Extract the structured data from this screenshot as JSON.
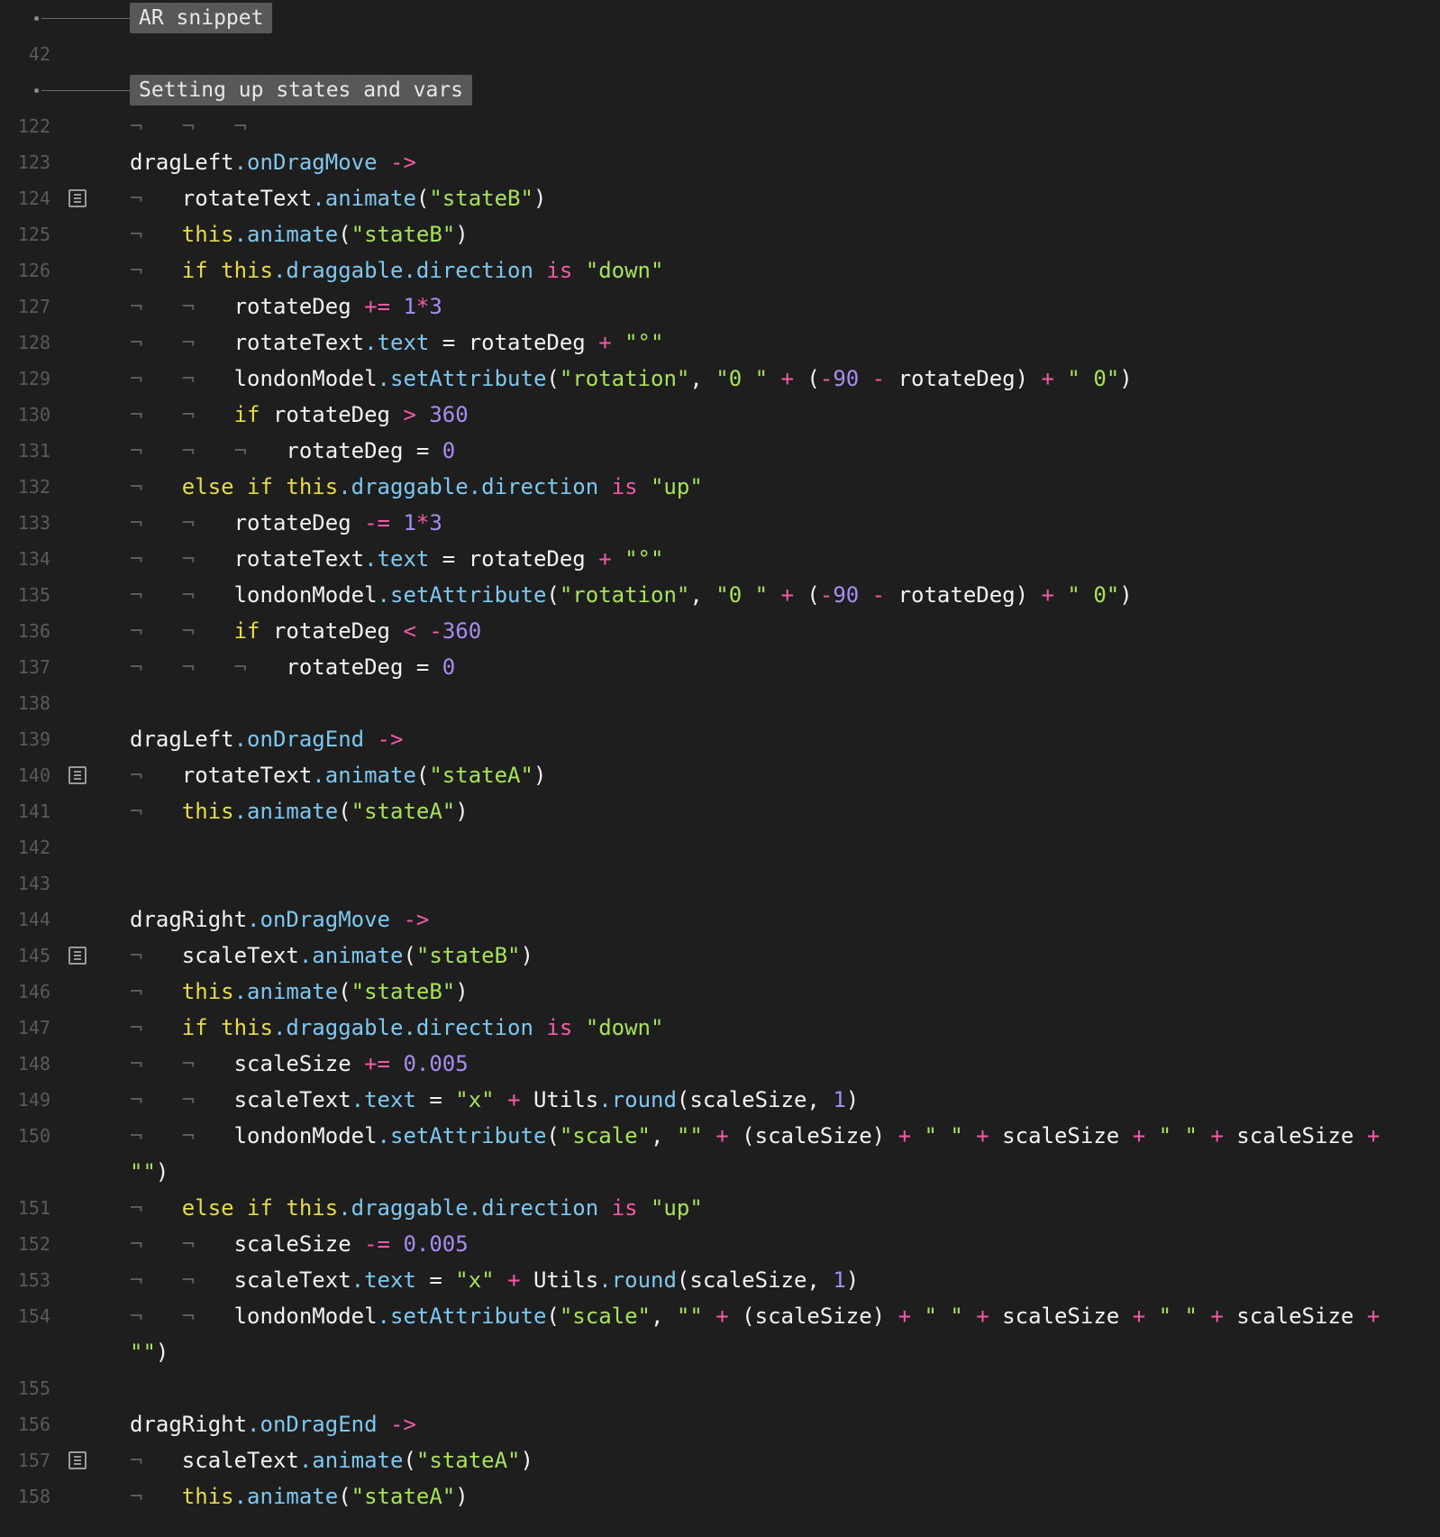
{
  "sections": [
    {
      "label": "AR snippet"
    },
    {
      "label": "Setting up states and vars"
    }
  ],
  "line_numbers": [
    "42",
    "122",
    "123",
    "124",
    "125",
    "126",
    "127",
    "128",
    "129",
    "130",
    "131",
    "132",
    "133",
    "134",
    "135",
    "136",
    "137",
    "138",
    "139",
    "140",
    "141",
    "142",
    "143",
    "144",
    "145",
    "146",
    "147",
    "148",
    "149",
    "150",
    "151",
    "152",
    "153",
    "154",
    "155",
    "156",
    "157",
    "158"
  ],
  "lines": [
    {
      "n": "122",
      "tabs": "¬   ¬   ¬",
      "fold": false,
      "tokens": []
    },
    {
      "n": "123",
      "tabs": "",
      "fold": false,
      "tokens": [
        [
          "v",
          "dragLeft"
        ],
        [
          "m",
          ".onDragMove"
        ],
        [
          "p",
          " "
        ],
        [
          "o",
          "->"
        ]
      ]
    },
    {
      "n": "124",
      "tabs": "¬   ",
      "fold": true,
      "tokens": [
        [
          "v",
          "rotateText"
        ],
        [
          "m",
          ".animate"
        ],
        [
          "p",
          "("
        ],
        [
          "s",
          "\"stateB\""
        ],
        [
          "p",
          ")"
        ]
      ]
    },
    {
      "n": "125",
      "tabs": "¬   ",
      "fold": false,
      "tokens": [
        [
          "k",
          "this"
        ],
        [
          "m",
          ".animate"
        ],
        [
          "p",
          "("
        ],
        [
          "s",
          "\"stateB\""
        ],
        [
          "p",
          ")"
        ]
      ]
    },
    {
      "n": "126",
      "tabs": "¬   ",
      "fold": false,
      "tokens": [
        [
          "k",
          "if this"
        ],
        [
          "m",
          ".draggable.direction"
        ],
        [
          "p",
          " "
        ],
        [
          "o",
          "is"
        ],
        [
          "p",
          " "
        ],
        [
          "s",
          "\"down\""
        ]
      ]
    },
    {
      "n": "127",
      "tabs": "¬   ¬   ",
      "fold": false,
      "tokens": [
        [
          "v",
          "rotateDeg "
        ],
        [
          "o",
          "+="
        ],
        [
          "p",
          " "
        ],
        [
          "n",
          "1"
        ],
        [
          "o",
          "*"
        ],
        [
          "n",
          "3"
        ]
      ]
    },
    {
      "n": "128",
      "tabs": "¬   ¬   ",
      "fold": false,
      "tokens": [
        [
          "v",
          "rotateText"
        ],
        [
          "m",
          ".text"
        ],
        [
          "p",
          " = rotateDeg "
        ],
        [
          "o",
          "+"
        ],
        [
          "p",
          " "
        ],
        [
          "s",
          "\"°\""
        ]
      ]
    },
    {
      "n": "129",
      "tabs": "¬   ¬   ",
      "fold": false,
      "tokens": [
        [
          "v",
          "londonModel"
        ],
        [
          "m",
          ".setAttribute"
        ],
        [
          "p",
          "("
        ],
        [
          "s",
          "\"rotation\""
        ],
        [
          "p",
          ", "
        ],
        [
          "s",
          "\"0 \""
        ],
        [
          "p",
          " "
        ],
        [
          "o",
          "+"
        ],
        [
          "p",
          " ("
        ],
        [
          "o",
          "-"
        ],
        [
          "n",
          "90"
        ],
        [
          "p",
          " "
        ],
        [
          "o",
          "-"
        ],
        [
          "p",
          " rotateDeg) "
        ],
        [
          "o",
          "+"
        ],
        [
          "p",
          " "
        ],
        [
          "s",
          "\" 0\""
        ],
        [
          "p",
          ")"
        ]
      ]
    },
    {
      "n": "130",
      "tabs": "¬   ¬   ",
      "fold": false,
      "tokens": [
        [
          "k",
          "if"
        ],
        [
          "p",
          " rotateDeg "
        ],
        [
          "o",
          ">"
        ],
        [
          "p",
          " "
        ],
        [
          "n",
          "360"
        ]
      ]
    },
    {
      "n": "131",
      "tabs": "¬   ¬   ¬   ",
      "fold": false,
      "tokens": [
        [
          "v",
          "rotateDeg = "
        ],
        [
          "n",
          "0"
        ]
      ]
    },
    {
      "n": "132",
      "tabs": "¬   ",
      "fold": false,
      "tokens": [
        [
          "k",
          "else if this"
        ],
        [
          "m",
          ".draggable.direction"
        ],
        [
          "p",
          " "
        ],
        [
          "o",
          "is"
        ],
        [
          "p",
          " "
        ],
        [
          "s",
          "\"up\""
        ]
      ]
    },
    {
      "n": "133",
      "tabs": "¬   ¬   ",
      "fold": false,
      "tokens": [
        [
          "v",
          "rotateDeg "
        ],
        [
          "o",
          "-="
        ],
        [
          "p",
          " "
        ],
        [
          "n",
          "1"
        ],
        [
          "o",
          "*"
        ],
        [
          "n",
          "3"
        ]
      ]
    },
    {
      "n": "134",
      "tabs": "¬   ¬   ",
      "fold": false,
      "tokens": [
        [
          "v",
          "rotateText"
        ],
        [
          "m",
          ".text"
        ],
        [
          "p",
          " = rotateDeg "
        ],
        [
          "o",
          "+"
        ],
        [
          "p",
          " "
        ],
        [
          "s",
          "\"°\""
        ]
      ]
    },
    {
      "n": "135",
      "tabs": "¬   ¬   ",
      "fold": false,
      "tokens": [
        [
          "v",
          "londonModel"
        ],
        [
          "m",
          ".setAttribute"
        ],
        [
          "p",
          "("
        ],
        [
          "s",
          "\"rotation\""
        ],
        [
          "p",
          ", "
        ],
        [
          "s",
          "\"0 \""
        ],
        [
          "p",
          " "
        ],
        [
          "o",
          "+"
        ],
        [
          "p",
          " ("
        ],
        [
          "o",
          "-"
        ],
        [
          "n",
          "90"
        ],
        [
          "p",
          " "
        ],
        [
          "o",
          "-"
        ],
        [
          "p",
          " rotateDeg) "
        ],
        [
          "o",
          "+"
        ],
        [
          "p",
          " "
        ],
        [
          "s",
          "\" 0\""
        ],
        [
          "p",
          ")"
        ]
      ]
    },
    {
      "n": "136",
      "tabs": "¬   ¬   ",
      "fold": false,
      "tokens": [
        [
          "k",
          "if"
        ],
        [
          "p",
          " rotateDeg "
        ],
        [
          "o",
          "<"
        ],
        [
          "p",
          " "
        ],
        [
          "o",
          "-"
        ],
        [
          "n",
          "360"
        ]
      ]
    },
    {
      "n": "137",
      "tabs": "¬   ¬   ¬   ",
      "fold": false,
      "tokens": [
        [
          "v",
          "rotateDeg = "
        ],
        [
          "n",
          "0"
        ]
      ]
    },
    {
      "n": "138",
      "tabs": "",
      "fold": false,
      "tokens": []
    },
    {
      "n": "139",
      "tabs": "",
      "fold": false,
      "tokens": [
        [
          "v",
          "dragLeft"
        ],
        [
          "m",
          ".onDragEnd"
        ],
        [
          "p",
          " "
        ],
        [
          "o",
          "->"
        ]
      ]
    },
    {
      "n": "140",
      "tabs": "¬   ",
      "fold": true,
      "tokens": [
        [
          "v",
          "rotateText"
        ],
        [
          "m",
          ".animate"
        ],
        [
          "p",
          "("
        ],
        [
          "s",
          "\"stateA\""
        ],
        [
          "p",
          ")"
        ]
      ]
    },
    {
      "n": "141",
      "tabs": "¬   ",
      "fold": false,
      "tokens": [
        [
          "k",
          "this"
        ],
        [
          "m",
          ".animate"
        ],
        [
          "p",
          "("
        ],
        [
          "s",
          "\"stateA\""
        ],
        [
          "p",
          ")"
        ]
      ]
    },
    {
      "n": "142",
      "tabs": "",
      "fold": false,
      "tokens": []
    },
    {
      "n": "143",
      "tabs": "",
      "fold": false,
      "tokens": []
    },
    {
      "n": "144",
      "tabs": "",
      "fold": false,
      "tokens": [
        [
          "v",
          "dragRight"
        ],
        [
          "m",
          ".onDragMove"
        ],
        [
          "p",
          " "
        ],
        [
          "o",
          "->"
        ]
      ]
    },
    {
      "n": "145",
      "tabs": "¬   ",
      "fold": true,
      "tokens": [
        [
          "v",
          "scaleText"
        ],
        [
          "m",
          ".animate"
        ],
        [
          "p",
          "("
        ],
        [
          "s",
          "\"stateB\""
        ],
        [
          "p",
          ")"
        ]
      ]
    },
    {
      "n": "146",
      "tabs": "¬   ",
      "fold": false,
      "tokens": [
        [
          "k",
          "this"
        ],
        [
          "m",
          ".animate"
        ],
        [
          "p",
          "("
        ],
        [
          "s",
          "\"stateB\""
        ],
        [
          "p",
          ")"
        ]
      ]
    },
    {
      "n": "147",
      "tabs": "¬   ",
      "fold": false,
      "tokens": [
        [
          "k",
          "if this"
        ],
        [
          "m",
          ".draggable.direction"
        ],
        [
          "p",
          " "
        ],
        [
          "o",
          "is"
        ],
        [
          "p",
          " "
        ],
        [
          "s",
          "\"down\""
        ]
      ]
    },
    {
      "n": "148",
      "tabs": "¬   ¬   ",
      "fold": false,
      "tokens": [
        [
          "v",
          "scaleSize "
        ],
        [
          "o",
          "+="
        ],
        [
          "p",
          " "
        ],
        [
          "n",
          "0.005"
        ]
      ]
    },
    {
      "n": "149",
      "tabs": "¬   ¬   ",
      "fold": false,
      "tokens": [
        [
          "v",
          "scaleText"
        ],
        [
          "m",
          ".text"
        ],
        [
          "p",
          " = "
        ],
        [
          "s",
          "\"x\""
        ],
        [
          "p",
          " "
        ],
        [
          "o",
          "+"
        ],
        [
          "p",
          " Utils"
        ],
        [
          "m",
          ".round"
        ],
        [
          "p",
          "(scaleSize, "
        ],
        [
          "n",
          "1"
        ],
        [
          "p",
          ")"
        ]
      ]
    },
    {
      "n": "150",
      "tabs": "¬   ¬   ",
      "fold": false,
      "tall": true,
      "tokens": [
        [
          "v",
          "londonModel"
        ],
        [
          "m",
          ".setAttribute"
        ],
        [
          "p",
          "("
        ],
        [
          "s",
          "\"scale\""
        ],
        [
          "p",
          ", "
        ],
        [
          "s",
          "\"\""
        ],
        [
          "p",
          " "
        ],
        [
          "o",
          "+"
        ],
        [
          "p",
          " (scaleSize) "
        ],
        [
          "o",
          "+"
        ],
        [
          "p",
          " "
        ],
        [
          "s",
          "\" \""
        ],
        [
          "p",
          " "
        ],
        [
          "o",
          "+"
        ],
        [
          "p",
          " scaleSize "
        ],
        [
          "o",
          "+"
        ],
        [
          "p",
          " "
        ],
        [
          "s",
          "\" \""
        ],
        [
          "p",
          " "
        ],
        [
          "o",
          "+"
        ],
        [
          "p",
          " scaleSize "
        ],
        [
          "o",
          "+"
        ],
        [
          "p",
          " "
        ],
        [
          "s",
          "\"\""
        ],
        [
          "p",
          ")"
        ]
      ]
    },
    {
      "n": "151",
      "tabs": "¬   ",
      "fold": false,
      "tokens": [
        [
          "k",
          "else if this"
        ],
        [
          "m",
          ".draggable.direction"
        ],
        [
          "p",
          " "
        ],
        [
          "o",
          "is"
        ],
        [
          "p",
          " "
        ],
        [
          "s",
          "\"up\""
        ]
      ]
    },
    {
      "n": "152",
      "tabs": "¬   ¬   ",
      "fold": false,
      "tokens": [
        [
          "v",
          "scaleSize "
        ],
        [
          "o",
          "-="
        ],
        [
          "p",
          " "
        ],
        [
          "n",
          "0.005"
        ]
      ]
    },
    {
      "n": "153",
      "tabs": "¬   ¬   ",
      "fold": false,
      "tokens": [
        [
          "v",
          "scaleText"
        ],
        [
          "m",
          ".text"
        ],
        [
          "p",
          " = "
        ],
        [
          "s",
          "\"x\""
        ],
        [
          "p",
          " "
        ],
        [
          "o",
          "+"
        ],
        [
          "p",
          " Utils"
        ],
        [
          "m",
          ".round"
        ],
        [
          "p",
          "(scaleSize, "
        ],
        [
          "n",
          "1"
        ],
        [
          "p",
          ")"
        ]
      ]
    },
    {
      "n": "154",
      "tabs": "¬   ¬   ",
      "fold": false,
      "tall": true,
      "tokens": [
        [
          "v",
          "londonModel"
        ],
        [
          "m",
          ".setAttribute"
        ],
        [
          "p",
          "("
        ],
        [
          "s",
          "\"scale\""
        ],
        [
          "p",
          ", "
        ],
        [
          "s",
          "\"\""
        ],
        [
          "p",
          " "
        ],
        [
          "o",
          "+"
        ],
        [
          "p",
          " (scaleSize) "
        ],
        [
          "o",
          "+"
        ],
        [
          "p",
          " "
        ],
        [
          "s",
          "\" \""
        ],
        [
          "p",
          " "
        ],
        [
          "o",
          "+"
        ],
        [
          "p",
          " scaleSize "
        ],
        [
          "o",
          "+"
        ],
        [
          "p",
          " "
        ],
        [
          "s",
          "\" \""
        ],
        [
          "p",
          " "
        ],
        [
          "o",
          "+"
        ],
        [
          "p",
          " scaleSize "
        ],
        [
          "o",
          "+"
        ],
        [
          "p",
          " "
        ],
        [
          "s",
          "\"\""
        ],
        [
          "p",
          ")"
        ]
      ]
    },
    {
      "n": "155",
      "tabs": "",
      "fold": false,
      "tokens": []
    },
    {
      "n": "156",
      "tabs": "",
      "fold": false,
      "tokens": [
        [
          "v",
          "dragRight"
        ],
        [
          "m",
          ".onDragEnd"
        ],
        [
          "p",
          " "
        ],
        [
          "o",
          "->"
        ]
      ]
    },
    {
      "n": "157",
      "tabs": "¬   ",
      "fold": true,
      "tokens": [
        [
          "v",
          "scaleText"
        ],
        [
          "m",
          ".animate"
        ],
        [
          "p",
          "("
        ],
        [
          "s",
          "\"stateA\""
        ],
        [
          "p",
          ")"
        ]
      ]
    },
    {
      "n": "158",
      "tabs": "¬   ",
      "fold": false,
      "tokens": [
        [
          "k",
          "this"
        ],
        [
          "m",
          ".animate"
        ],
        [
          "p",
          "("
        ],
        [
          "s",
          "\"stateA\""
        ],
        [
          "p",
          ")"
        ]
      ]
    }
  ],
  "colors": {
    "background": "#1e1e1e",
    "keyword": "#e6db4a",
    "method": "#7ec8f0",
    "string": "#a6e25a",
    "operator": "#f35aa8",
    "number": "#a98cf0",
    "text": "#f2f2f2",
    "gutter": "#5a5a5a",
    "section_label_bg": "#585858"
  },
  "icons": {
    "fold": "comment-fold-icon"
  }
}
